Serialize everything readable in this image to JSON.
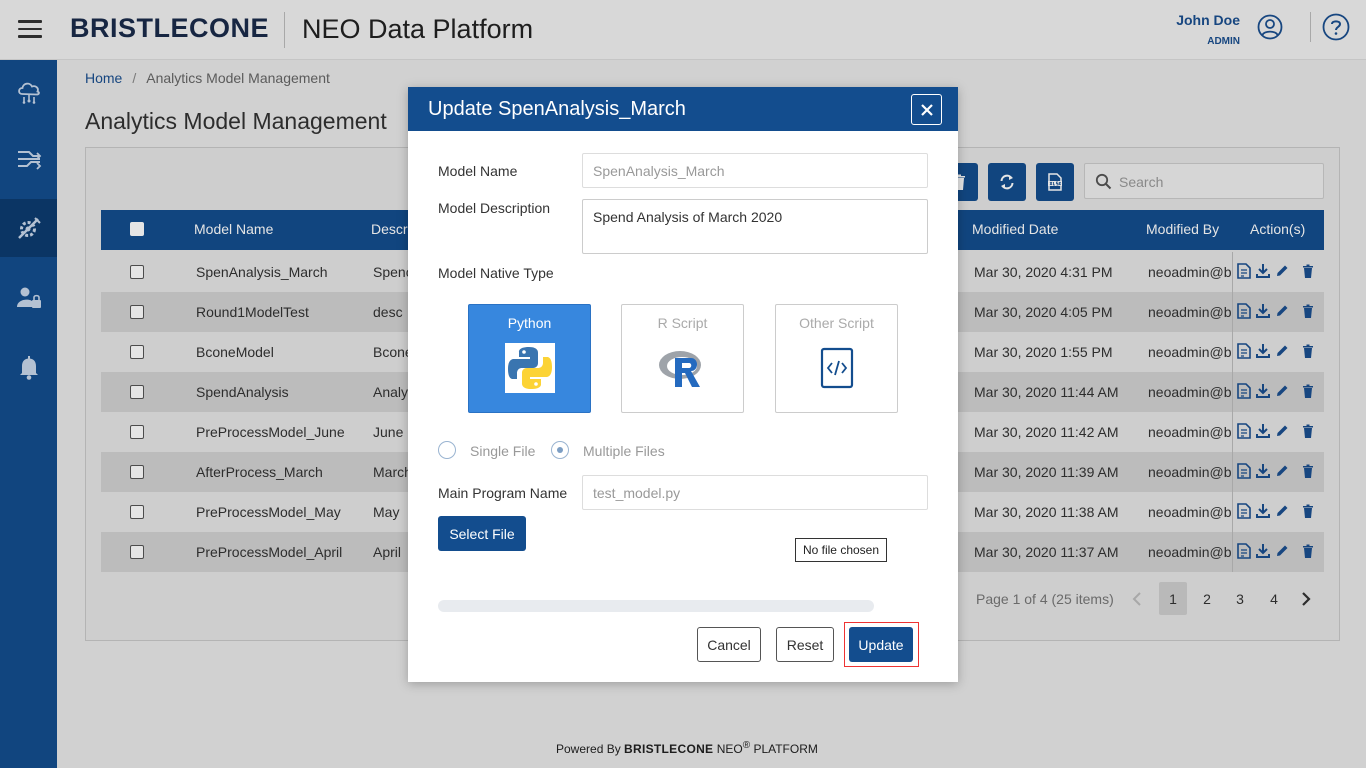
{
  "header": {
    "brand": "BRISTLECONE",
    "product": "NEO Data Platform",
    "user_name": "John Doe",
    "user_role": "ADMIN"
  },
  "breadcrumb": {
    "home": "Home",
    "current": "Analytics Model Management"
  },
  "page_title": "Analytics Model Management",
  "search": {
    "placeholder": "Search",
    "value": ""
  },
  "table": {
    "headers": {
      "model_name": "Model Name",
      "description": "Descri",
      "modified_date": "Modified Date",
      "modified_by": "Modified By",
      "actions": "Action(s)"
    },
    "rows": [
      {
        "name": "SpenAnalysis_March",
        "desc": "Spenc",
        "date": "Mar 30, 2020 4:31 PM",
        "by": "neoadmin@bc"
      },
      {
        "name": "Round1ModelTest",
        "desc": "desc",
        "date": "Mar 30, 2020 4:05 PM",
        "by": "neoadmin@bc"
      },
      {
        "name": "BconeModel",
        "desc": "Bcone",
        "date": "Mar 30, 2020 1:55 PM",
        "by": "neoadmin@bc"
      },
      {
        "name": "SpendAnalysis",
        "desc": "Analy",
        "date": "Mar 30, 2020 11:44 AM",
        "by": "neoadmin@bc"
      },
      {
        "name": "PreProcessModel_June",
        "desc": "June",
        "date": "Mar 30, 2020 11:42 AM",
        "by": "neoadmin@bc"
      },
      {
        "name": "AfterProcess_March",
        "desc": "March",
        "date": "Mar 30, 2020 11:39 AM",
        "by": "neoadmin@bc"
      },
      {
        "name": "PreProcessModel_May",
        "desc": "May",
        "date": "Mar 30, 2020 11:38 AM",
        "by": "neoadmin@bc"
      },
      {
        "name": "PreProcessModel_April",
        "desc": "April",
        "date": "Mar 30, 2020 11:37 AM",
        "by": "neoadmin@bc"
      }
    ]
  },
  "pager": {
    "info": "Page 1 of 4 (25 items)",
    "pages": [
      "1",
      "2",
      "3",
      "4"
    ],
    "current": "1"
  },
  "footer": {
    "powered_by": "Powered By",
    "brand": "BRISTLECONE",
    "neo": "NEO",
    "sup": "®",
    "platform": "PLATFORM"
  },
  "modal": {
    "title": "Update SpenAnalysis_March",
    "model_name_label": "Model Name",
    "model_name_value": "SpenAnalysis_March",
    "model_desc_label": "Model Description",
    "model_desc_value": "Spend Analysis of March 2020",
    "native_type_label": "Model Native Type",
    "types": [
      "Python",
      "R Script",
      "Other Script"
    ],
    "selected_type": "Python",
    "file_mode_options": [
      "Single File",
      "Multiple Files"
    ],
    "file_mode_selected": "Multiple Files",
    "main_program_label": "Main Program Name",
    "main_program_value": "test_model.py",
    "select_file_label": "Select File",
    "no_file_text": "No file chosen",
    "upload_progress": 0,
    "cancel_label": "Cancel",
    "reset_label": "Reset",
    "update_label": "Update"
  },
  "colors": {
    "primary": "#134d8e",
    "python_card": "#3787de",
    "focus_outline": "#ee3333"
  },
  "icons": {
    "sidebar": [
      "cloud-network-icon",
      "data-pipeline-icon",
      "settings-tools-icon",
      "user-lock-icon",
      "bell-icon"
    ],
    "toolbar": [
      "delete-icon",
      "refresh-icon",
      "xlsx-export-icon"
    ],
    "row_actions": [
      "view-notes-icon",
      "download-icon",
      "edit-icon",
      "trash-icon"
    ]
  }
}
